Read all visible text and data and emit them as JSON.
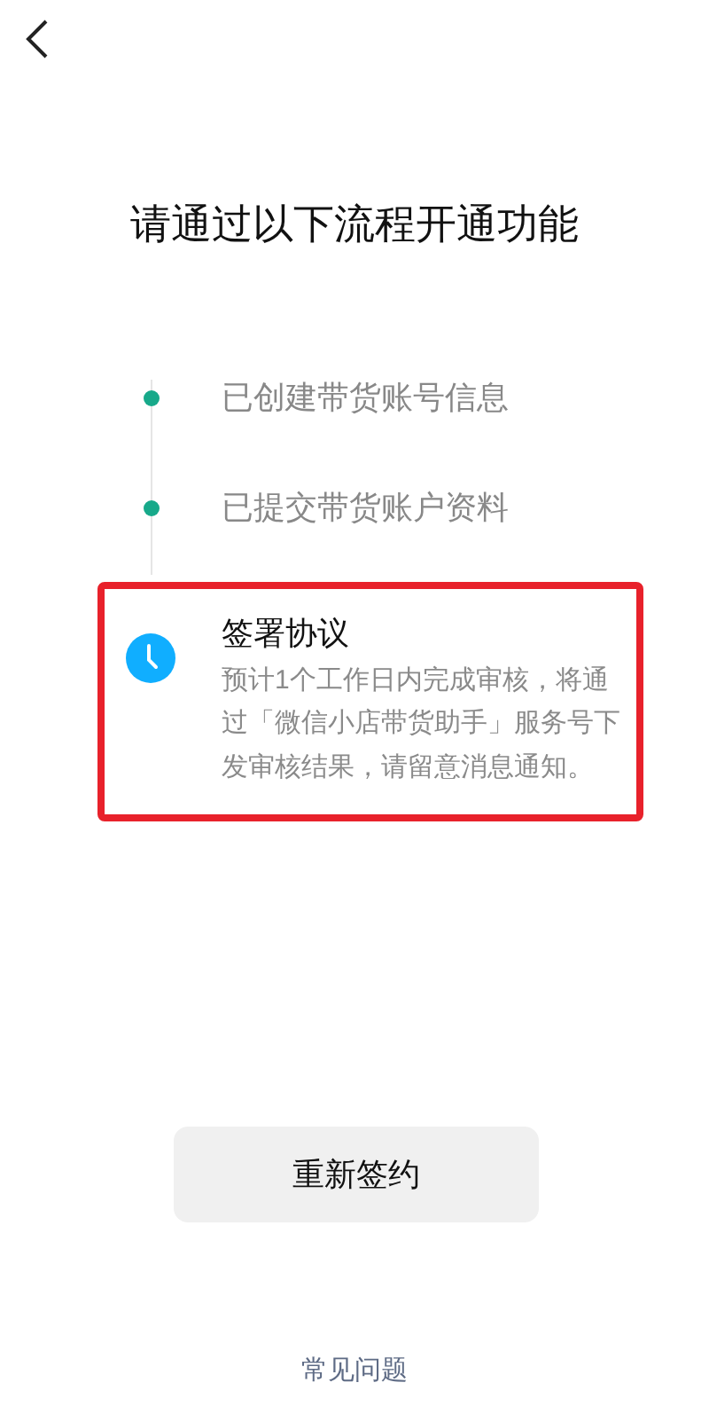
{
  "title": "请通过以下流程开通功能",
  "steps": [
    {
      "kind": "done",
      "label": "已创建带货账号信息",
      "highlighted": false
    },
    {
      "kind": "done",
      "label": "已提交带货账户资料",
      "highlighted": false
    },
    {
      "kind": "pending",
      "label": "签署协议",
      "description": "预计1个工作日内完成审核，将通过「微信小店带货助手」服务号下发审核结果，请留意消息通知。",
      "highlighted": true
    }
  ],
  "button": "重新签约",
  "footer_link": "常见问题"
}
